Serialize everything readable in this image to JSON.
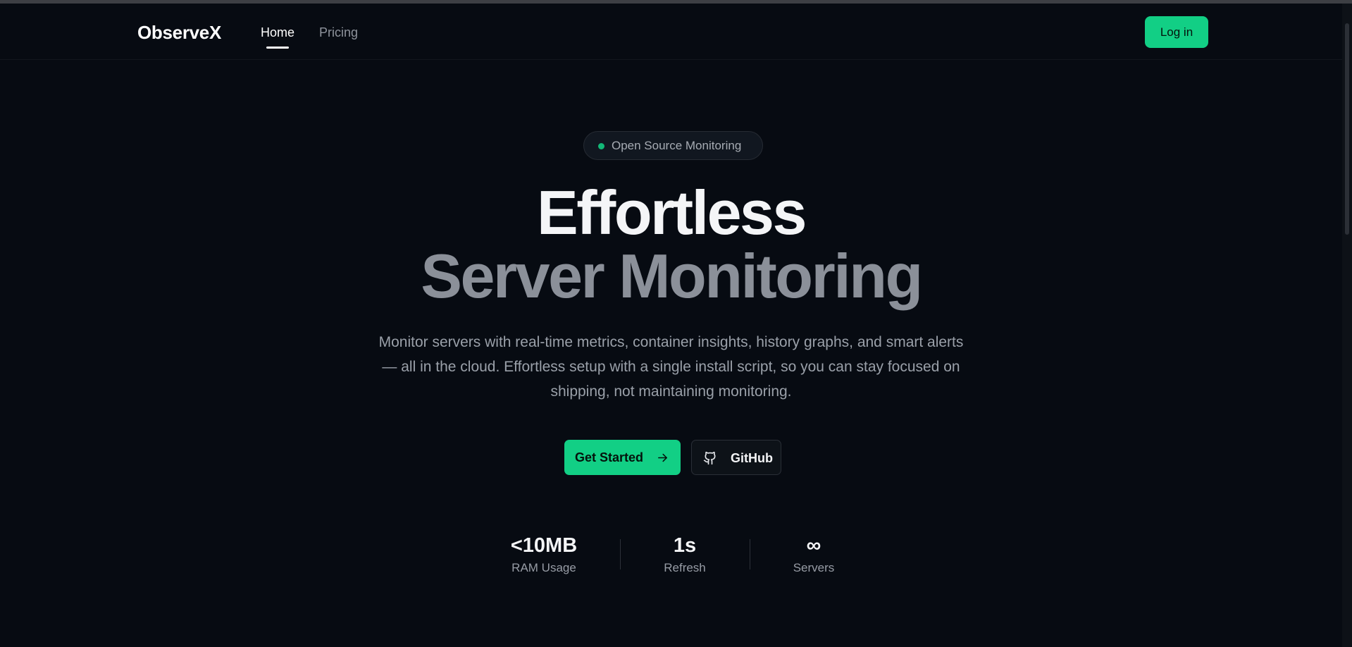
{
  "nav": {
    "brand": "ObserveX",
    "links": [
      {
        "label": "Home",
        "active": true
      },
      {
        "label": "Pricing",
        "active": false
      }
    ],
    "login_label": "Log in"
  },
  "hero": {
    "badge": "Open Source Monitoring",
    "headline_line1": "Effortless",
    "headline_line2": "Server Monitoring",
    "subtitle": "Monitor servers with real-time metrics, container insights, history graphs, and smart alerts — all in the cloud. Effortless setup with a single install script, so you can stay focused on shipping, not maintaining monitoring.",
    "primary_cta": "Get Started",
    "secondary_cta": "GitHub"
  },
  "stats": [
    {
      "value": "<10MB",
      "label": "RAM Usage"
    },
    {
      "value": "1s",
      "label": "Refresh"
    },
    {
      "value": "∞",
      "label": "Servers"
    }
  ],
  "icons": {
    "primary_cta_icon": "arrow-right-icon",
    "secondary_cta_icon": "github-icon",
    "badge_icon": "status-dot-icon"
  },
  "colors": {
    "background": "#070b12",
    "accent": "#12cf85",
    "headline_primary": "#f4f5f7",
    "headline_secondary": "#8b9099",
    "muted_text": "#9aa0a9"
  }
}
